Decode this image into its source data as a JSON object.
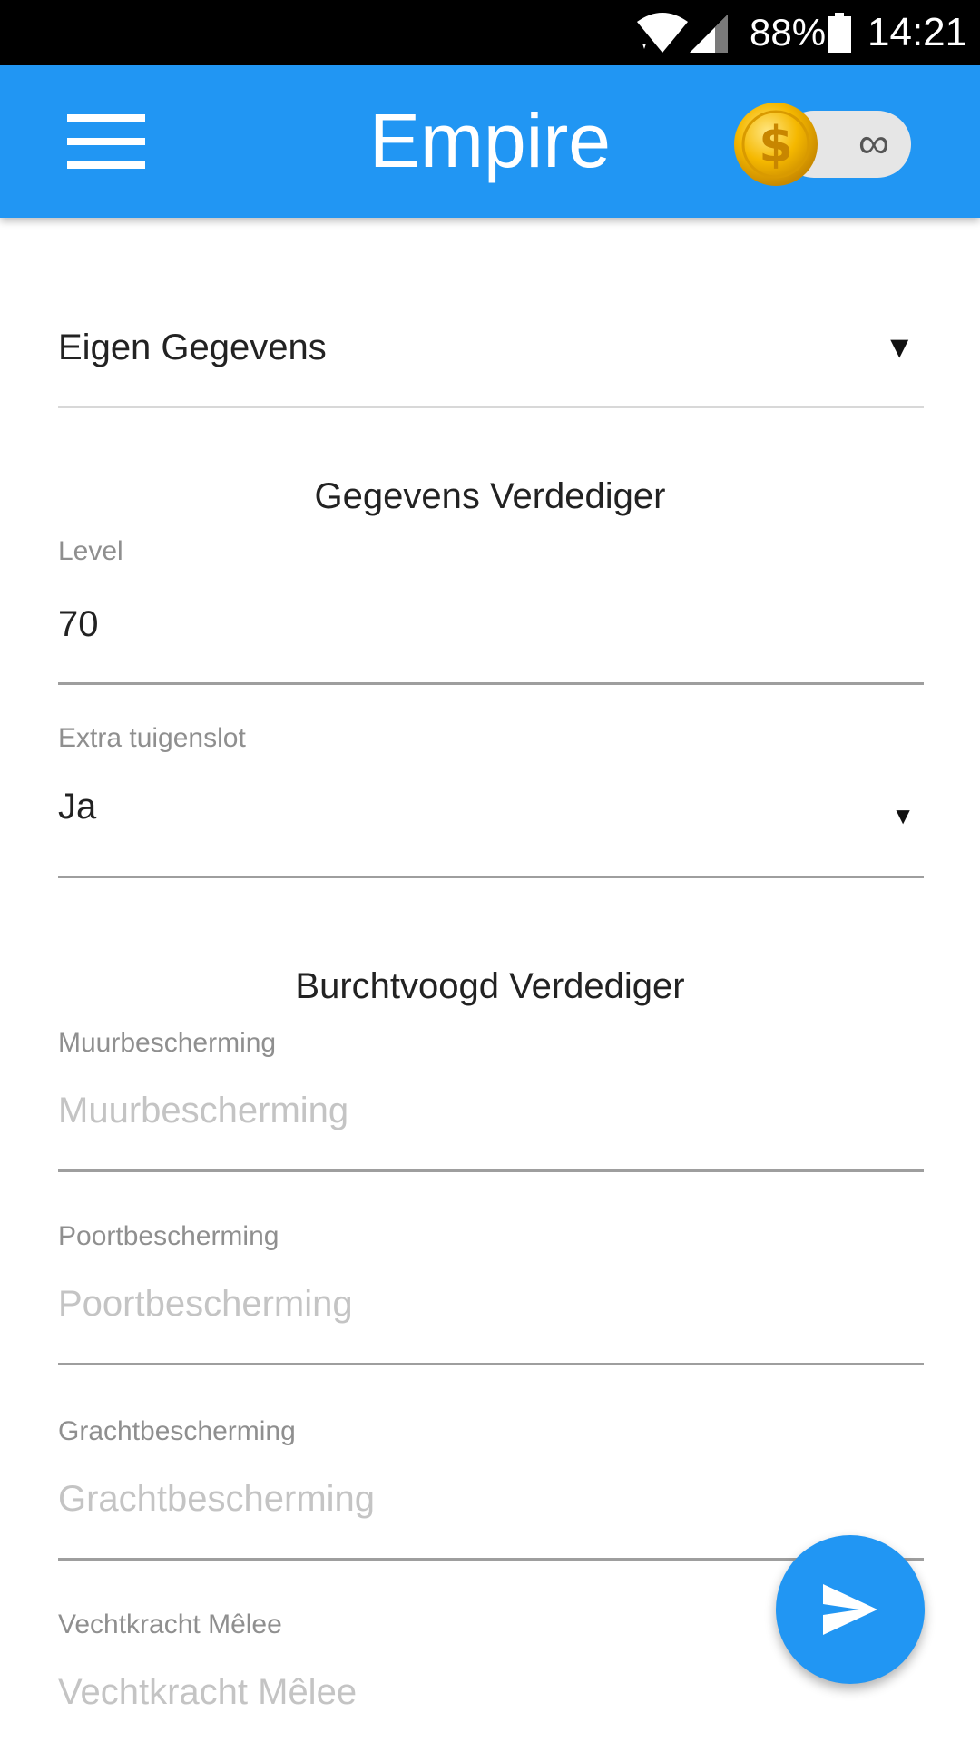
{
  "status_bar": {
    "battery_percent": "88%",
    "time": "14:21",
    "icons": [
      "wifi-icon",
      "signal-icon",
      "battery-icon"
    ]
  },
  "app_bar": {
    "title": "Empire",
    "menu_icon": "menu-icon",
    "coin_toggle": {
      "icon": "coin-dollar-icon",
      "value": "∞"
    },
    "background_color": "#2196F3"
  },
  "form": {
    "mode_spinner": {
      "value": "Eigen Gegevens"
    },
    "defender_section": {
      "title": "Gegevens Verdediger",
      "level": {
        "label": "Level",
        "value": "70"
      },
      "extra_tool_slot": {
        "label": "Extra tuigenslot",
        "value": "Ja"
      }
    },
    "castellan_section": {
      "title": "Burchtvoogd Verdediger",
      "fields": [
        {
          "label": "Muurbescherming",
          "placeholder": "Muurbescherming",
          "value": ""
        },
        {
          "label": "Poortbescherming",
          "placeholder": "Poortbescherming",
          "value": ""
        },
        {
          "label": "Grachtbescherming",
          "placeholder": "Grachtbescherming",
          "value": ""
        },
        {
          "label": "Vechtkracht Mêlee",
          "placeholder": "Vechtkracht Mêlee",
          "value": ""
        }
      ]
    }
  },
  "fab": {
    "icon": "send-icon",
    "color": "#2196F3"
  }
}
